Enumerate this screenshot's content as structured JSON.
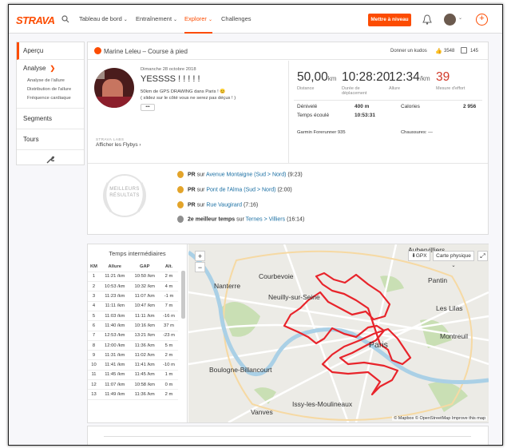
{
  "header": {
    "logo": "STRAVA",
    "nav": [
      "Tableau de bord",
      "Entraînement",
      "Explorer",
      "Challenges"
    ],
    "upgrade_label": "Mettre à niveau"
  },
  "sidebar": {
    "overview": "Aperçu",
    "analysis": "Analyse",
    "analysis_sub": [
      "Analyse de l'allure",
      "Distribution de l'allure",
      "Fréquence cardiaque"
    ],
    "segments": "Segments",
    "laps": "Tours"
  },
  "activity": {
    "title": "Marine Leleu – Course à pied",
    "give_kudos": "Donner un kudos",
    "kudos_count": "3548",
    "comment_count": "145",
    "date": "Dimanche 28 octobre 2018",
    "name": "YESSSS ! ! ! ! !",
    "description_1": "50km de GPS DRAWING dans Paris ! 😊",
    "description_2": "( slidez sur le côté vous ne serez pas déçus ! )",
    "more": "•••",
    "labs_label": "STRAVA LABS",
    "flyby": "Afficher les Flybys",
    "distance": "50,00",
    "distance_unit": "km",
    "distance_label": "Distance",
    "moving_time": "10:28:20",
    "moving_time_label": "Durée de déplacement",
    "pace": "12:34",
    "pace_unit": "/km",
    "pace_label": "Allure",
    "effort": "39",
    "effort_label": "Mesure d'effort",
    "elev_label": "Dénivelé",
    "elev": "400",
    "elev_unit": "m",
    "elapsed_label": "Temps écoulé",
    "elapsed": "10:53:31",
    "cal_label": "Calories",
    "cal": "2 956",
    "device": "Garmin Forerunner 935",
    "shoes": "Chaussures: —"
  },
  "best": {
    "badge_1": "MEILLEURS",
    "badge_2": "RÉSULTATS",
    "items": [
      {
        "prefix": "PR",
        "sur": "sur",
        "link": "Avenue Montaigne (Sud > Nord)",
        "time": "(9:23)"
      },
      {
        "prefix": "PR",
        "sur": "sur",
        "link": "Pont de l'Alma (Sud > Nord)",
        "time": "(2:00)"
      },
      {
        "prefix": "PR",
        "sur": "sur",
        "link": "Rue Vaugirard",
        "time": "(7:16)"
      },
      {
        "prefix": "2e meilleur temps",
        "sur": "sur",
        "link": "Ternes > Villiers",
        "time": "(16:14)"
      }
    ]
  },
  "splits": {
    "title": "Temps intermédiaires",
    "headers": [
      "KM",
      "Allure",
      "GAP",
      "Alt."
    ],
    "rows": [
      [
        "1",
        "11:21 /km",
        "10:50 /km",
        "2 m"
      ],
      [
        "2",
        "10:53 /km",
        "10:32 /km",
        "4 m"
      ],
      [
        "3",
        "11:23 /km",
        "11:07 /km",
        "-1 m"
      ],
      [
        "4",
        "11:11 /km",
        "10:47 /km",
        "7 m"
      ],
      [
        "5",
        "11:03 /km",
        "11:11 /km",
        "-16 m"
      ],
      [
        "6",
        "11:40 /km",
        "10:16 /km",
        "37 m"
      ],
      [
        "7",
        "12:53 /km",
        "13:21 /km",
        "-23 m"
      ],
      [
        "8",
        "12:00 /km",
        "11:36 /km",
        "5 m"
      ],
      [
        "9",
        "11:31 /km",
        "11:02 /km",
        "2 m"
      ],
      [
        "10",
        "11:41 /km",
        "11:41 /km",
        "-10 m"
      ],
      [
        "11",
        "11:45 /km",
        "11:45 /km",
        "1 m"
      ],
      [
        "12",
        "11:07 /km",
        "10:58 /km",
        "0 m"
      ],
      [
        "13",
        "11:49 /km",
        "11:36 /km",
        "2 m"
      ]
    ]
  },
  "map": {
    "gpx": "GPX",
    "layer": "Carte physique",
    "attribution": "© Mapbox © OpenStreetMap Improve this map",
    "places": [
      "Nanterre",
      "Courbevoie",
      "Neuilly-sur-Seine",
      "Paris",
      "Les Lilas",
      "Montreuil",
      "Boulogne-Billancourt",
      "Issy-les-Moulineaux",
      "Aubervilliers",
      "Vanves",
      "Pantin"
    ]
  },
  "colors": {
    "accent": "#fc4c02",
    "route": "#e8242b",
    "link": "#1a6fa3"
  }
}
